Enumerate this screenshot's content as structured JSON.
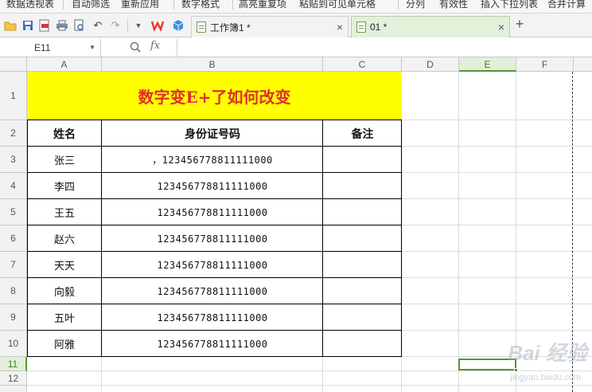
{
  "ribbon": {
    "items": [
      "数据透视表",
      "自动筛选",
      "重新应用",
      "数字格式",
      "高亮重复项",
      "粘贴到可见单元格",
      "分列",
      "有效性",
      "插入下拉列表",
      "合并计算"
    ]
  },
  "toolbar": {
    "icons": [
      "open-folder-icon",
      "save-icon",
      "export-pdf-icon",
      "print-icon",
      "print-preview-icon",
      "undo-icon",
      "redo-icon",
      "dropdown-icon",
      "wps-logo-icon",
      "cube-icon"
    ],
    "tabs": [
      {
        "label": "工作簿1 *",
        "active": false
      },
      {
        "label": "01 *",
        "active": true
      }
    ],
    "new_tab": "+",
    "close": "×"
  },
  "formula_bar": {
    "name_box": "E11",
    "fx": "fx",
    "formula": ""
  },
  "columns": [
    "A",
    "B",
    "C",
    "D",
    "E",
    "F"
  ],
  "selected_column": "E",
  "rows": [
    "1",
    "2",
    "3",
    "4",
    "5",
    "6",
    "7",
    "8",
    "9",
    "10",
    "11",
    "12"
  ],
  "selected_row": "11",
  "table": {
    "title": "数字变E+了如何改变",
    "headers": [
      "姓名",
      "身份证号码",
      "备注"
    ],
    "records": [
      {
        "name": "张三",
        "id": "，123456778811111000",
        "note": ""
      },
      {
        "name": "李四",
        "id": "123456778811111000",
        "note": ""
      },
      {
        "name": "王五",
        "id": "123456778811111000",
        "note": ""
      },
      {
        "name": "赵六",
        "id": "123456778811111000",
        "note": ""
      },
      {
        "name": "天天",
        "id": "123456778811111000",
        "note": ""
      },
      {
        "name": "向毅",
        "id": "123456778811111000",
        "note": ""
      },
      {
        "name": "五叶",
        "id": "123456778811111000",
        "note": ""
      },
      {
        "name": "阿雅",
        "id": "123456778811111000",
        "note": ""
      }
    ]
  },
  "colors": {
    "title_bg": "#ffff00",
    "title_text": "#e0302a",
    "selection": "#4e9a2d"
  },
  "watermark": {
    "text": "Bai 经验",
    "sub": "jingyan.baidu.com"
  }
}
